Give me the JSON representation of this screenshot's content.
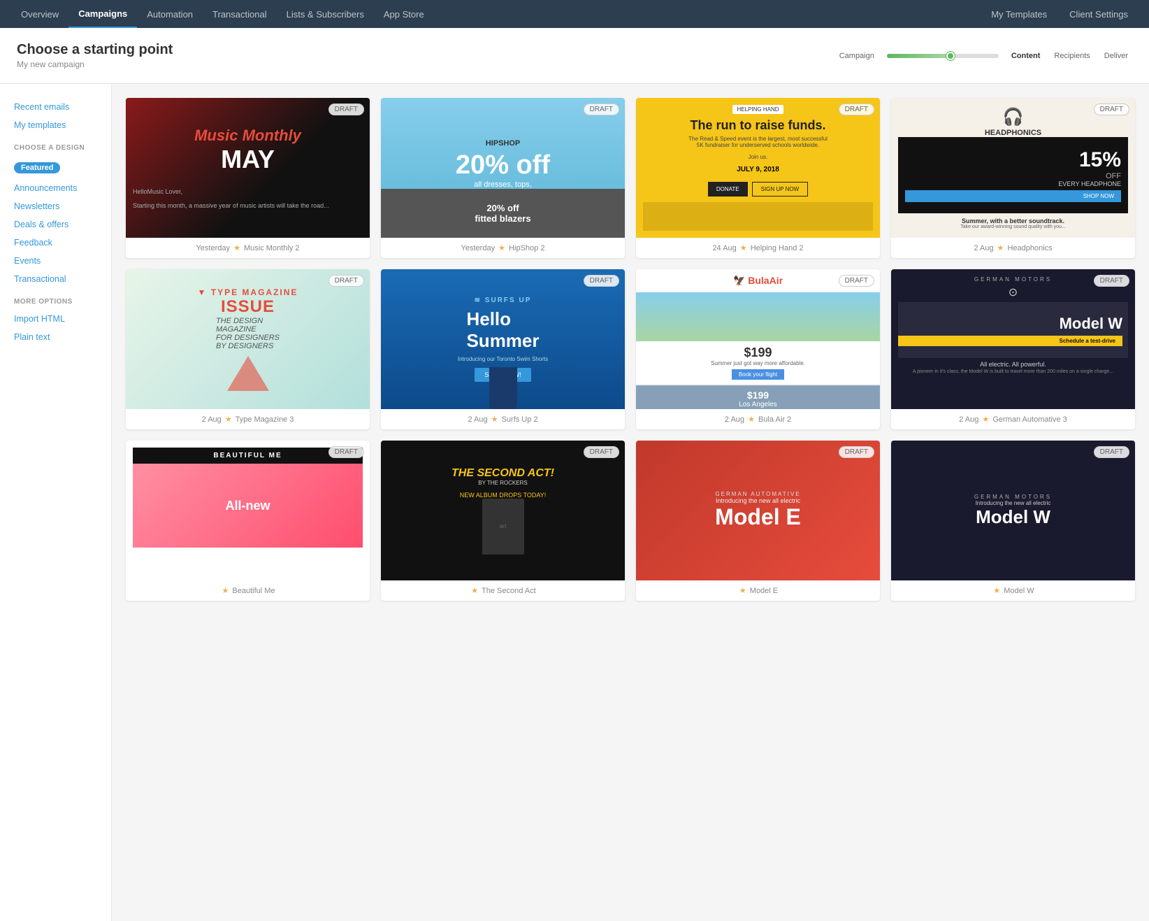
{
  "nav": {
    "items": [
      {
        "label": "Overview",
        "active": false
      },
      {
        "label": "Campaigns",
        "active": true
      },
      {
        "label": "Automation",
        "active": false
      },
      {
        "label": "Transactional",
        "active": false
      },
      {
        "label": "Lists & Subscribers",
        "active": false
      },
      {
        "label": "App Store",
        "active": false
      }
    ],
    "right_items": [
      {
        "label": "My Templates"
      },
      {
        "label": "Client Settings"
      }
    ]
  },
  "header": {
    "title": "Choose a starting point",
    "subtitle": "My new campaign",
    "progress": {
      "steps": [
        "Campaign",
        "Content",
        "Recipients",
        "Deliver"
      ],
      "active": "Content"
    }
  },
  "sidebar": {
    "quick_links": [
      {
        "label": "Recent emails",
        "id": "recent-emails"
      },
      {
        "label": "My templates",
        "id": "my-templates"
      }
    ],
    "choose_design_title": "CHOOSE A DESIGN",
    "featured_label": "Featured",
    "design_items": [
      {
        "label": "Announcements",
        "id": "announcements"
      },
      {
        "label": "Newsletters",
        "id": "newsletters"
      },
      {
        "label": "Deals & offers",
        "id": "deals-offers"
      },
      {
        "label": "Feedback",
        "id": "feedback"
      },
      {
        "label": "Events",
        "id": "events"
      },
      {
        "label": "Transactional",
        "id": "transactional"
      }
    ],
    "more_options_title": "MORE OPTIONS",
    "more_options": [
      {
        "label": "Import HTML",
        "id": "import-html"
      },
      {
        "label": "Plain text",
        "id": "plain-text"
      }
    ]
  },
  "templates": {
    "row1": [
      {
        "date": "Yesterday",
        "star": "★",
        "name": "Music Monthly 2",
        "badge": "DRAFT",
        "type": "music"
      },
      {
        "date": "Yesterday",
        "star": "★",
        "name": "HipShop 2",
        "badge": "DRAFT",
        "type": "hipshop"
      },
      {
        "date": "24 Aug",
        "star": "★",
        "name": "Helping Hand 2",
        "badge": "DRAFT",
        "type": "helping"
      },
      {
        "date": "2 Aug",
        "star": "★",
        "name": "Headphonics",
        "badge": "DRAFT",
        "type": "headphones"
      }
    ],
    "row2": [
      {
        "date": "2 Aug",
        "star": "★",
        "name": "Type Magazine 3",
        "badge": "DRAFT",
        "type": "type"
      },
      {
        "date": "2 Aug",
        "star": "★",
        "name": "Surfs Up 2",
        "badge": "DRAFT",
        "type": "surfs"
      },
      {
        "date": "2 Aug",
        "star": "★",
        "name": "Bula Air 2",
        "badge": "DRAFT",
        "type": "bula"
      },
      {
        "date": "2 Aug",
        "star": "★",
        "name": "German Automative 3",
        "badge": "DRAFT",
        "type": "german"
      }
    ],
    "row3": [
      {
        "date": "",
        "star": "★",
        "name": "Beautiful Me",
        "badge": "DRAFT",
        "type": "beautiful"
      },
      {
        "date": "",
        "star": "★",
        "name": "The Second Act",
        "badge": "DRAFT",
        "type": "second"
      },
      {
        "date": "",
        "star": "★",
        "name": "Model E",
        "badge": "DRAFT",
        "type": "model-e"
      },
      {
        "date": "",
        "star": "★",
        "name": "Model W",
        "badge": "DRAFT",
        "type": "model-w"
      }
    ]
  }
}
